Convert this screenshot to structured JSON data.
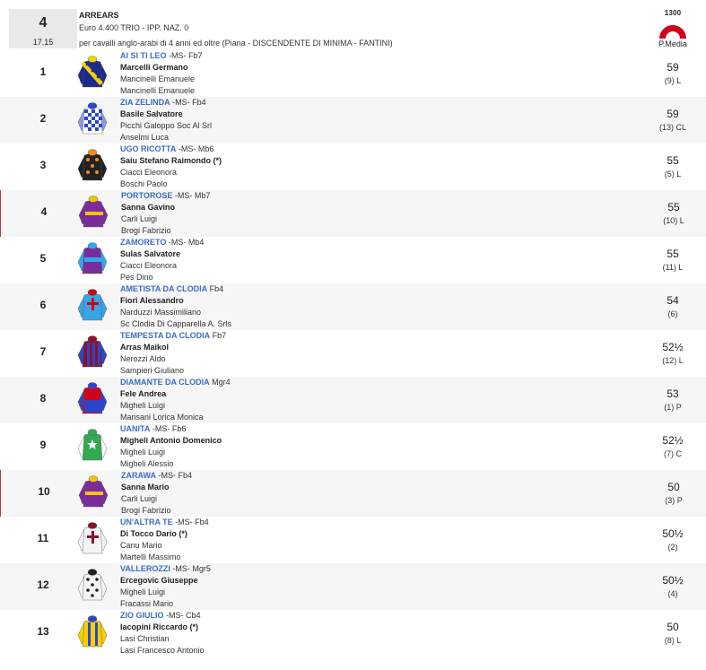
{
  "race": {
    "number": "4",
    "time": "17.15",
    "title": "ARREARS",
    "prize": "Euro 4.400 TRIO - IPP. NAZ. 0",
    "conditions": "per cavalli anglo-arabi di 4 anni ed oltre (Piana -  DISCENDENTE DI MINIMA  - FANTINI)",
    "distance": "1300",
    "distance_label": "P.Media"
  },
  "runners": [
    {
      "num": "1",
      "horse": "AI SI TI LEO",
      "info": " -MS- Fb7",
      "jockey": "Marcelli Germano",
      "trainer": "Mancinelli Emanuele",
      "owner": "Mancinelli Emanuele",
      "weight": "59",
      "draw": "(9) L",
      "silk": "navy-yellow-sash"
    },
    {
      "num": "2",
      "horse": "ZIA ZELINDA",
      "info": " -MS- Fb4",
      "jockey": "Basile Salvatore",
      "trainer": "Picchi Galoppo Soc Al Srl",
      "owner": "Anselmi Luca",
      "weight": "59",
      "draw": "(13) CL",
      "silk": "blue-white-check"
    },
    {
      "num": "3",
      "horse": "UGO RICOTTA",
      "info": " -MS- Mb6",
      "jockey": "Saiu Stefano Raimondo (*)",
      "trainer": "Ciacci Eleonora",
      "owner": "Boschi Paolo",
      "weight": "55",
      "draw": "(5) L",
      "silk": "black-orange-spots"
    },
    {
      "num": "4",
      "horse": "PORTOROSE",
      "info": " -MS- Mb7",
      "jockey": "Sanna Gavino",
      "trainer": "Carli Luigi",
      "owner": "Brogi Fabrizio",
      "weight": "55",
      "draw": "(10) L",
      "silk": "purple-yellow-hoop"
    },
    {
      "num": "5",
      "horse": "ZAMORETO",
      "info": " -MS- Mb4",
      "jockey": "Sulas Salvatore",
      "trainer": "Ciacci Eleonora",
      "owner": "Pes Dino",
      "weight": "55",
      "draw": "(11) L",
      "silk": "purple-cyan-band"
    },
    {
      "num": "6",
      "horse": "AMETISTA DA CLODIA",
      "info": " Fb4",
      "jockey": "Fiori Alessandro",
      "trainer": "Narduzzi Massimiliano",
      "owner": "Sc Clodia Di Capparella A. Srls",
      "weight": "54",
      "draw": "(6)",
      "silk": "cyan-red-cross"
    },
    {
      "num": "7",
      "horse": "TEMPESTA DA CLODIA",
      "info": " Fb7",
      "jockey": "Arras Maikol",
      "trainer": "Nerozzi Aldo",
      "owner": "Sampieri Giuliano",
      "weight": "52½",
      "draw": "(12) L",
      "silk": "maroon-blue-stripes"
    },
    {
      "num": "8",
      "horse": "DIAMANTE DA CLODIA",
      "info": " Mgr4",
      "jockey": "Fele Andrea",
      "trainer": "Migheli Luigi",
      "owner": "Mansani Lorica Monica",
      "weight": "53",
      "draw": "(1) P",
      "silk": "red-blue-halves"
    },
    {
      "num": "9",
      "horse": "UANITA",
      "info": " -MS- Fb6",
      "jockey": "Migheli Antonio Domenico",
      "trainer": "Migheli Luigi",
      "owner": "Migheli Alessio",
      "weight": "52½",
      "draw": "(7) C",
      "silk": "green-white-star"
    },
    {
      "num": "10",
      "horse": "ZARAWA",
      "info": " -MS- Fb4",
      "jockey": "Sanna Mario",
      "trainer": "Carli Luigi",
      "owner": "Brogi Fabrizio",
      "weight": "50",
      "draw": "(3) P",
      "silk": "purple-yellow-hoop"
    },
    {
      "num": "11",
      "horse": "UN'ALTRA TE",
      "info": " -MS- Fb4",
      "jockey": "Di Tocco Dario (*)",
      "trainer": "Canu Mario",
      "owner": "Martelli Massimo",
      "weight": "50½",
      "draw": "(2)",
      "silk": "white-maroon-cross"
    },
    {
      "num": "12",
      "horse": "VALLEROZZI",
      "info": " -MS- Mgr5",
      "jockey": "Ercegovic Giuseppe",
      "trainer": "Migheli Luigi",
      "owner": "Fracassi Mario",
      "weight": "50½",
      "draw": "(4)",
      "silk": "white-black-spots"
    },
    {
      "num": "13",
      "horse": "ZIO GIULIO",
      "info": " -MS- Cb4",
      "jockey": "Iacopini Riccardo (*)",
      "trainer": "Lasi Christian",
      "owner": "Lasi Francesco Antonio",
      "weight": "50",
      "draw": "(8) L",
      "silk": "yellow-blue-stripes"
    }
  ]
}
